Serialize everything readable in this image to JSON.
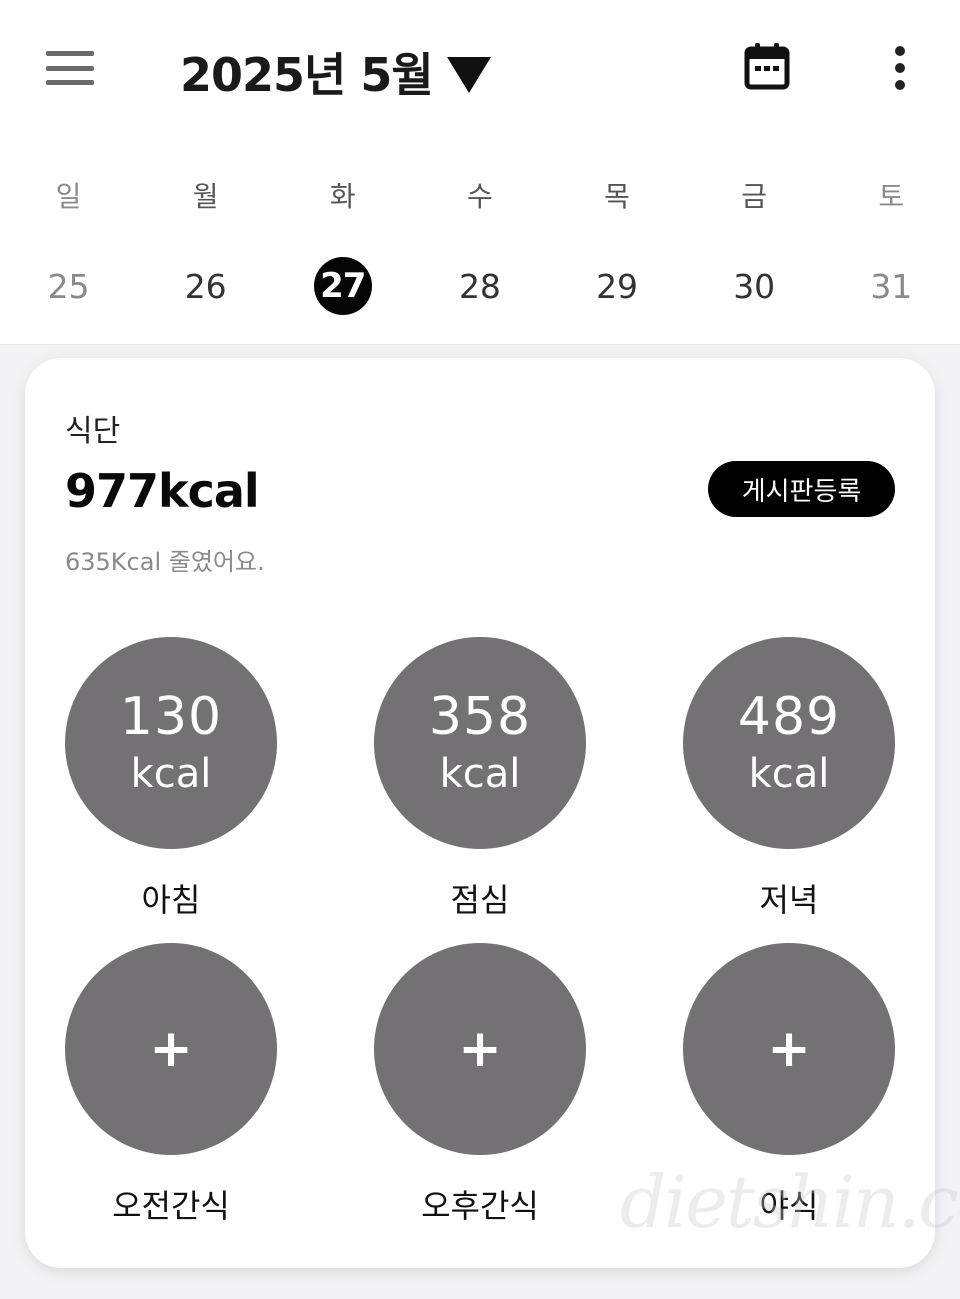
{
  "header": {
    "title": "2025년 5월"
  },
  "week": {
    "days": [
      "일",
      "월",
      "화",
      "수",
      "목",
      "금",
      "토"
    ],
    "dates": [
      "25",
      "26",
      "27",
      "28",
      "29",
      "30",
      "31"
    ],
    "selected": "27"
  },
  "diet": {
    "label": "식단",
    "total": "977kcal",
    "post_button": "게시판등록",
    "diff": "635Kcal 줄였어요.",
    "meals": [
      {
        "name": "아침",
        "value": "130",
        "unit": "kcal"
      },
      {
        "name": "점심",
        "value": "358",
        "unit": "kcal"
      },
      {
        "name": "저녁",
        "value": "489",
        "unit": "kcal"
      },
      {
        "name": "오전간식",
        "value": "+"
      },
      {
        "name": "오후간식",
        "value": "+"
      },
      {
        "name": "야식",
        "value": "+"
      }
    ]
  },
  "watermark": "dietshin.com",
  "colors": {
    "circle": "#737174",
    "accent": "#000000",
    "background": "#f3f2f5"
  }
}
